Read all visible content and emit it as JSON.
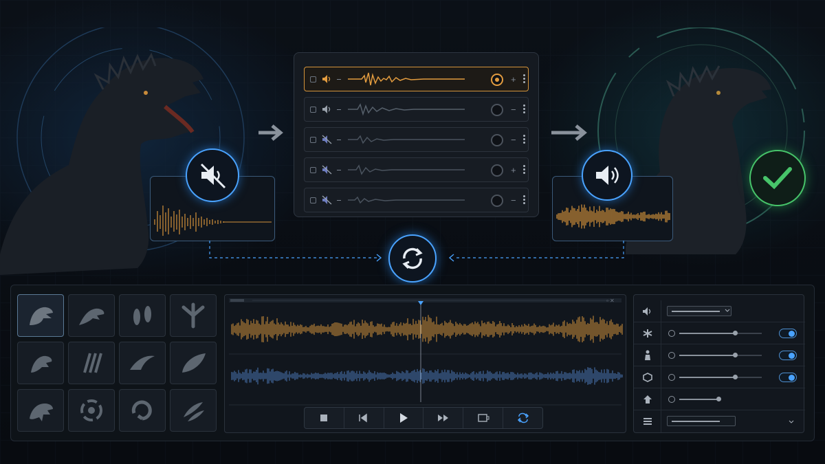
{
  "colors": {
    "accent_orange": "#e39c3f",
    "accent_blue": "#4aa3ff",
    "accent_green": "#47c46a",
    "panel_bg": "#12171e"
  },
  "before_state": {
    "icon": "speaker-muted-icon"
  },
  "after_state": {
    "icon": "speaker-on-icon",
    "status_icon": "checkmark-icon"
  },
  "sync_icon": "sync-icon",
  "tracks": [
    {
      "icon": "speaker-on-icon",
      "active": true
    },
    {
      "icon": "speaker-on-icon",
      "active": false
    },
    {
      "icon": "speaker-muted-icon",
      "active": false
    },
    {
      "icon": "speaker-muted-icon",
      "active": false
    },
    {
      "icon": "speaker-muted-icon",
      "active": false
    }
  ],
  "creature_library": [
    "dino-head-roar-icon",
    "dino-head-side-icon",
    "footprints-icon",
    "claw-track-icon",
    "dino-head-small-icon",
    "claw-marks-icon",
    "wing-swoosh-icon",
    "leaf-tail-icon",
    "dino-skull-icon",
    "sound-wave-circle-icon",
    "swirl-icon",
    "feather-pair-icon"
  ],
  "transport": [
    "stop-icon",
    "rewind-icon",
    "play-icon",
    "fast-forward-icon",
    "clip-icon",
    "loop-icon"
  ],
  "properties": [
    {
      "icon": "speaker-on-icon",
      "control": "dropdown"
    },
    {
      "icon": "asterisk-icon",
      "control": "slider-toggle",
      "level": 0.82,
      "enabled": true
    },
    {
      "icon": "figure-icon",
      "control": "slider-toggle",
      "level": 0.82,
      "enabled": true
    },
    {
      "icon": "cube-icon",
      "control": "slider-toggle",
      "level": 0.82,
      "enabled": true
    },
    {
      "icon": "home-up-icon",
      "control": "slider",
      "level": 0.6
    },
    {
      "icon": "list-icon",
      "control": "dropdown"
    }
  ]
}
